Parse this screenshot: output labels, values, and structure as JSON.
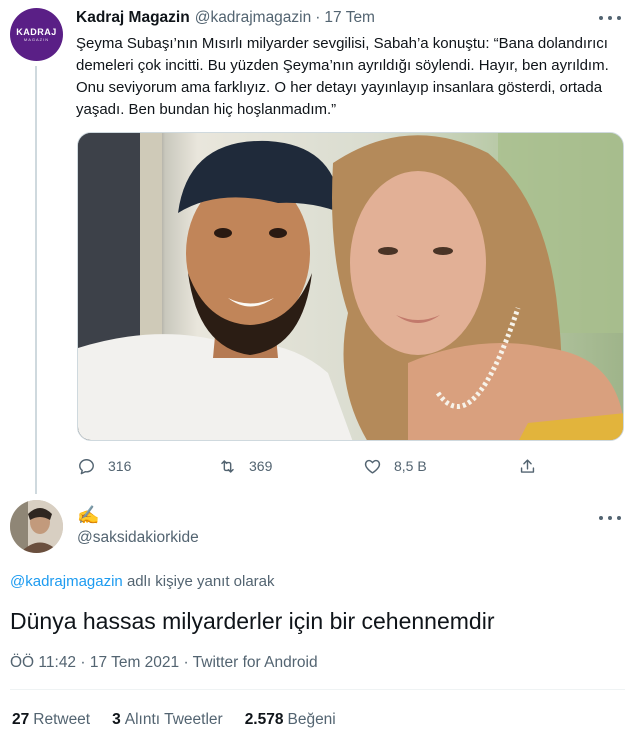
{
  "parent_tweet": {
    "avatar_logo": "KADRAJ",
    "avatar_logo_sub": "MAGAZIN",
    "display_name": "Kadraj Magazin",
    "handle": "@kadrajmagazin",
    "separator": "·",
    "time": "17 Tem",
    "text": "Şeyma Subaşı’nın Mısırlı milyarder sevgilisi, Sabah’a konuştu: “Bana dolandırıcı demeleri çok incitti. Bu yüzden Şeyma’nın ayrıldığı söylendi. Hayır, ben ayrıldım. Onu seviyorum ama farklıyız. O her detayı yayınlayıp insanlara gösterdi, ortada yaşadı. Ben bundan hiç hoşlanmadım.”",
    "media_icon": "photo-couple-selfie",
    "actions": {
      "reply_count": "316",
      "retweet_count": "369",
      "like_count": "8,5 B"
    }
  },
  "main_tweet": {
    "display_name": "✍️",
    "handle": "@saksidakiorkide",
    "reply_prefix": "adlı kişiye yanıt olarak",
    "reply_to": "@kadrajmagazin",
    "text": "Dünya hassas milyarderler için bir cehennemdir",
    "meta": "ÖÖ 11:42 · 17 Tem 2021 · Twitter for Android",
    "stats": {
      "retweets_count": "27",
      "retweets_label": "Retweet",
      "quotes_count": "3",
      "quotes_label": "Alıntı Tweetler",
      "likes_count": "2.578",
      "likes_label": "Beğeni"
    }
  },
  "colors": {
    "accent": "#1d9bf0",
    "secondary_text": "#536471",
    "avatar_bg": "#5a1f86"
  }
}
